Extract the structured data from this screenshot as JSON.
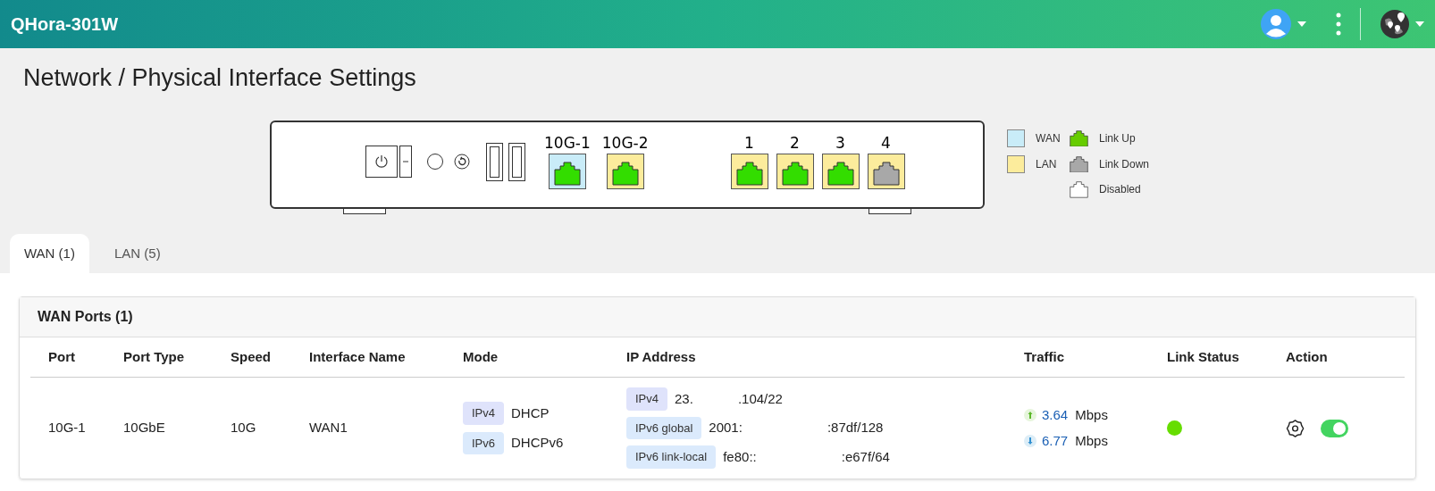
{
  "header": {
    "title": "QHora-301W"
  },
  "page_title": "Network / Physical Interface Settings",
  "device": {
    "ports": [
      {
        "label": "10G-1",
        "wan": true,
        "link_up": true
      },
      {
        "label": "10G-2",
        "wan": false,
        "link_up": true
      },
      {
        "label": "1",
        "wan": false,
        "link_up": true
      },
      {
        "label": "2",
        "wan": false,
        "link_up": true
      },
      {
        "label": "3",
        "wan": false,
        "link_up": true
      },
      {
        "label": "4",
        "wan": false,
        "link_up": false
      }
    ]
  },
  "legend": [
    {
      "kind": "wan",
      "label": "WAN"
    },
    {
      "kind": "up",
      "label": "Link Up"
    },
    {
      "kind": "lan",
      "label": "LAN"
    },
    {
      "kind": "down",
      "label": "Link Down"
    },
    {
      "kind": "disabled",
      "label": "Disabled"
    }
  ],
  "tabs": [
    {
      "label": "WAN (1)",
      "selected": true
    },
    {
      "label": "LAN (5)",
      "selected": false
    }
  ],
  "card": {
    "title": "WAN Ports (1)",
    "columns": [
      "Port",
      "Port Type",
      "Speed",
      "Interface Name",
      "Mode",
      "IP Address",
      "Traffic",
      "Link Status",
      "Action"
    ],
    "rows": [
      {
        "port": "10G-1",
        "port_type": "10GbE",
        "speed": "10G",
        "interface_name": "WAN1",
        "mode": [
          {
            "tag": "IPv4",
            "value": "DHCP"
          },
          {
            "tag": "IPv6",
            "value": "DHCPv6"
          }
        ],
        "ip": [
          {
            "tag": "IPv4",
            "kind": "v4",
            "start": "23.",
            "end": ".104/22"
          },
          {
            "tag": "IPv6 global",
            "kind": "v6",
            "start": "2001:",
            "end": ":87df/128"
          },
          {
            "tag": "IPv6 link-local",
            "kind": "v6",
            "start": "fe80::",
            "end": ":e67f/64"
          }
        ],
        "traffic": [
          {
            "kind": "upload",
            "value": "3.64",
            "unit": "Mbps"
          },
          {
            "kind": "download",
            "value": "6.77",
            "unit": "Mbps"
          }
        ],
        "link_up": true,
        "enabled": true
      }
    ]
  }
}
